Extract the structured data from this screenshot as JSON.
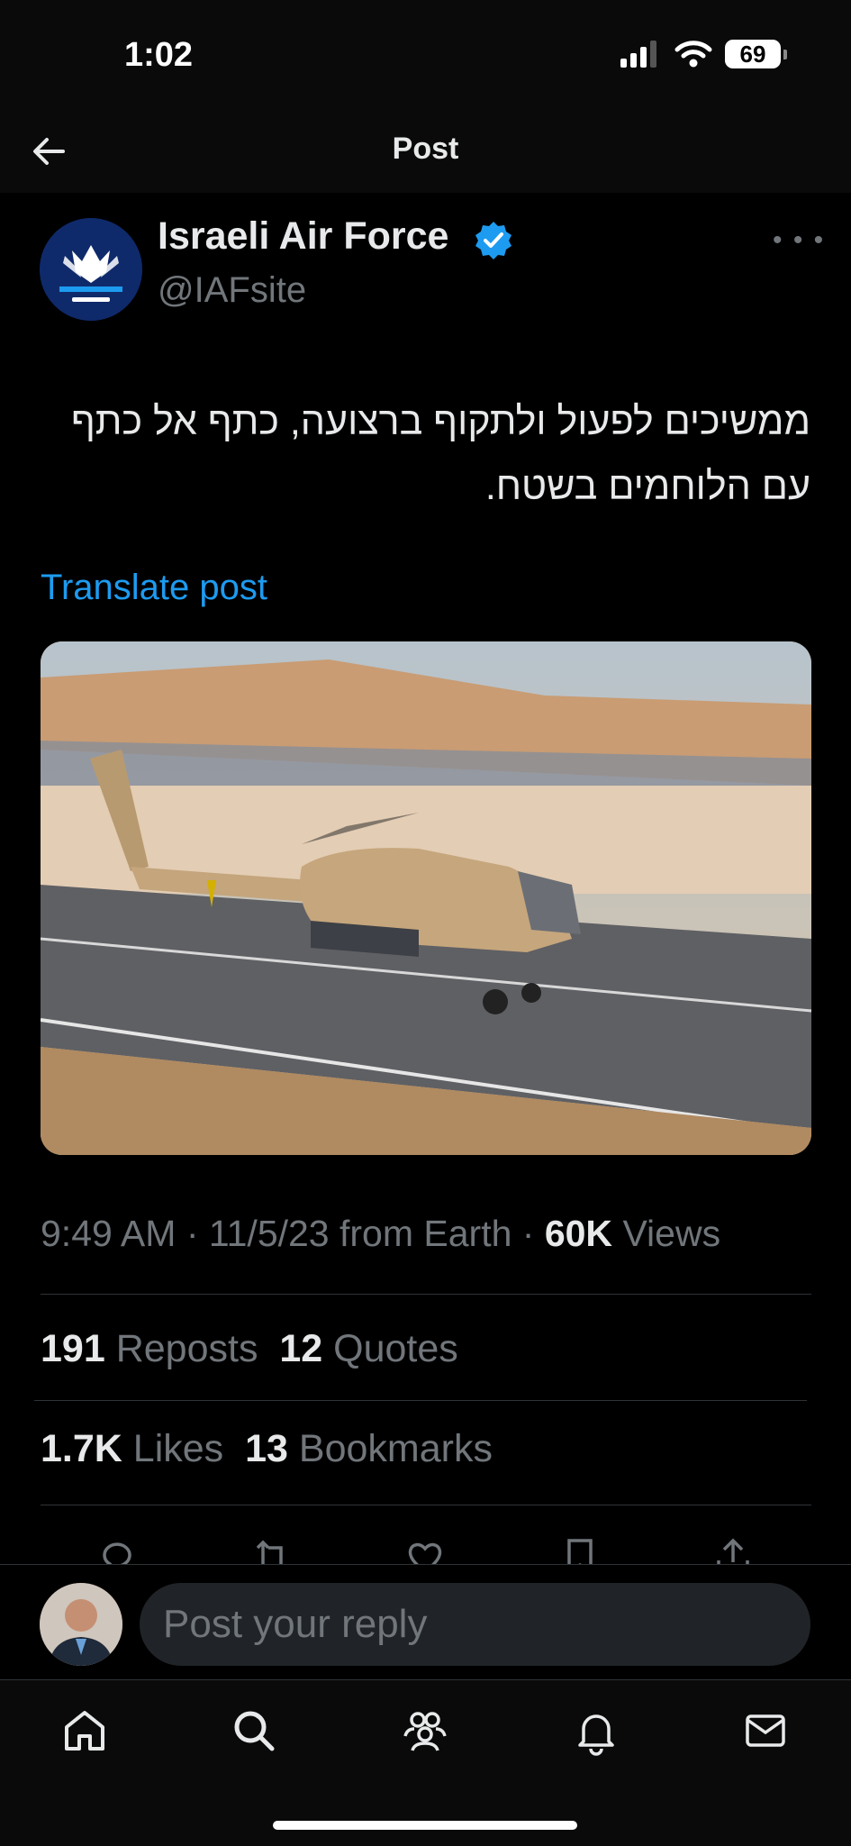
{
  "status_bar": {
    "time": "1:02",
    "battery": "69"
  },
  "header": {
    "title": "Post"
  },
  "post": {
    "author_name": "Israeli Air Force",
    "handle": "@IAFsite",
    "text": "ממשיכים לפעול ולתקוף ברצועה, כתף אל כתף עם הלוחמים בשטח.",
    "translate_label": "Translate post",
    "timestamp": "9:49 AM · 11/5/23 from Earth · ",
    "views_count": "60K",
    "views_label": " Views",
    "stats": {
      "reposts_count": "191",
      "reposts_label": "Reposts",
      "quotes_count": "12",
      "quotes_label": "Quotes",
      "likes_count": "1.7K",
      "likes_label": "Likes",
      "bookmarks_count": "13",
      "bookmarks_label": "Bookmarks"
    }
  },
  "reply": {
    "placeholder": "Post your reply"
  },
  "icons": {
    "back": "back-arrow-icon",
    "verified": "verified-badge-icon",
    "more": "more-icon",
    "reply": "reply-icon",
    "repost": "repost-icon",
    "like": "heart-icon",
    "bookmark": "bookmark-icon",
    "share": "share-icon",
    "tabs": [
      "home-icon",
      "search-icon",
      "communities-icon",
      "notifications-icon",
      "messages-icon"
    ]
  },
  "colors": {
    "accent": "#1d9bf0",
    "verified": "#1d9bf0",
    "background": "#000000",
    "muted": "#71767b"
  }
}
